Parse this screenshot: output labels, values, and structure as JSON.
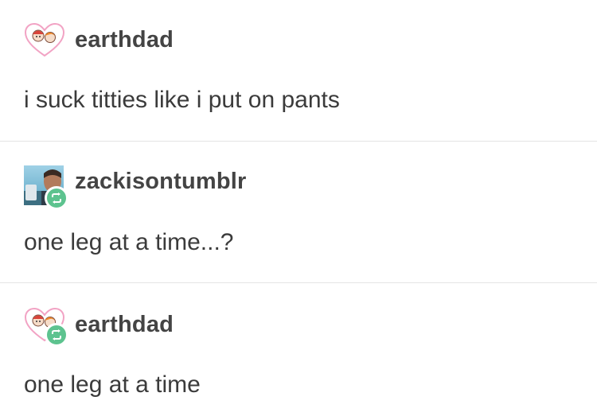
{
  "posts": [
    {
      "username": "earthdad",
      "avatar_icon": "heart-couple-icon",
      "reblogged": false,
      "text": "i suck titties like i put on pants"
    },
    {
      "username": "zackisontumblr",
      "avatar_icon": "photo-avatar",
      "reblogged": true,
      "text": "one leg at a time...?"
    },
    {
      "username": "earthdad",
      "avatar_icon": "heart-couple-icon",
      "reblogged": true,
      "text": "one leg at a time"
    }
  ],
  "colors": {
    "reblog_badge": "#5dc38f",
    "heart_outline": "#f2a3c4",
    "divider": "#e4e4e4",
    "text": "#3b3b3b"
  }
}
